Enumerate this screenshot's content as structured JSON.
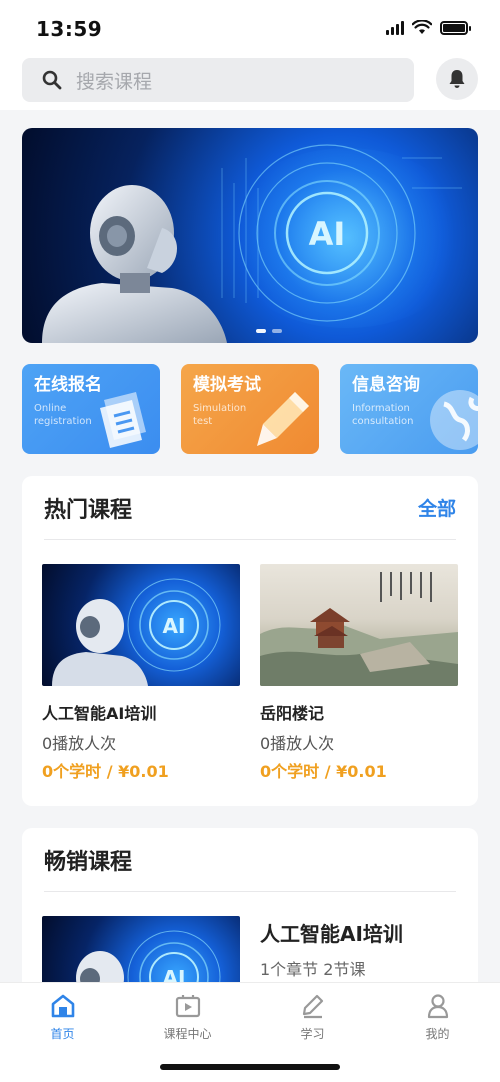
{
  "status_bar": {
    "time": "13:59"
  },
  "search": {
    "placeholder": "搜索课程"
  },
  "quick_links": [
    {
      "title": "在线报名",
      "subtitle": "Online registration",
      "icon": "document-icon",
      "color": "#3b8df0"
    },
    {
      "title": "模拟考试",
      "subtitle": "Simulation test",
      "icon": "pencil-icon",
      "color": "#f08a32"
    },
    {
      "title": "信息咨询",
      "subtitle": "Information consultation",
      "icon": "globe-icon",
      "color": "#4a9cf0"
    }
  ],
  "hot_courses": {
    "title": "热门课程",
    "more_label": "全部",
    "items": [
      {
        "name": "人工智能AI培训",
        "plays": "0播放人次",
        "price": "0个学时 / ¥0.01"
      },
      {
        "name": "岳阳楼记",
        "plays": "0播放人次",
        "price": "0个学时 / ¥0.01"
      }
    ]
  },
  "bestsellers": {
    "title": "畅销课程",
    "items": [
      {
        "name": "人工智能AI培训",
        "meta": "1个章节 2节课"
      }
    ]
  },
  "tabbar": {
    "items": [
      {
        "label": "首页",
        "icon": "home-icon",
        "active": true
      },
      {
        "label": "课程中心",
        "icon": "video-icon",
        "active": false
      },
      {
        "label": "学习",
        "icon": "pen-icon",
        "active": false
      },
      {
        "label": "我的",
        "icon": "person-icon",
        "active": false
      }
    ]
  },
  "colors": {
    "accent": "#2f84e8",
    "price": "#f0a020"
  }
}
